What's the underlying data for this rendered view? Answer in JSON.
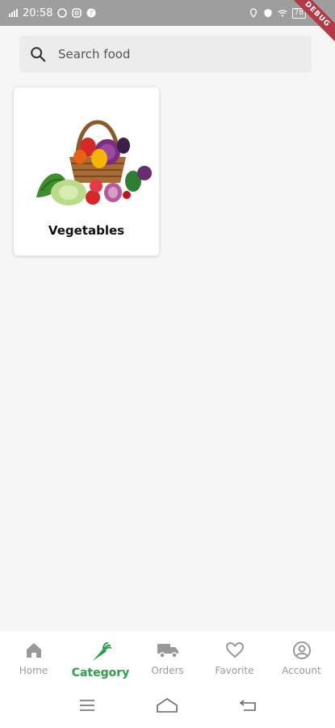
{
  "status_bar": {
    "time": "20:58",
    "battery": "78"
  },
  "debug_banner": "DEBUG",
  "search": {
    "placeholder": "Search food"
  },
  "categories": [
    {
      "label": "Vegetables",
      "icon": "vegetable-basket-image"
    }
  ],
  "bottom_nav": {
    "items": [
      {
        "label": "Home",
        "icon": "home-icon"
      },
      {
        "label": "Category",
        "icon": "carrot-icon"
      },
      {
        "label": "Orders",
        "icon": "truck-icon"
      },
      {
        "label": "Favorite",
        "icon": "heart-icon"
      },
      {
        "label": "Account",
        "icon": "account-icon"
      }
    ],
    "active_index": 1
  },
  "colors": {
    "accent": "#2e9e4a",
    "inactive": "#999999",
    "background": "#f6f6f6"
  }
}
